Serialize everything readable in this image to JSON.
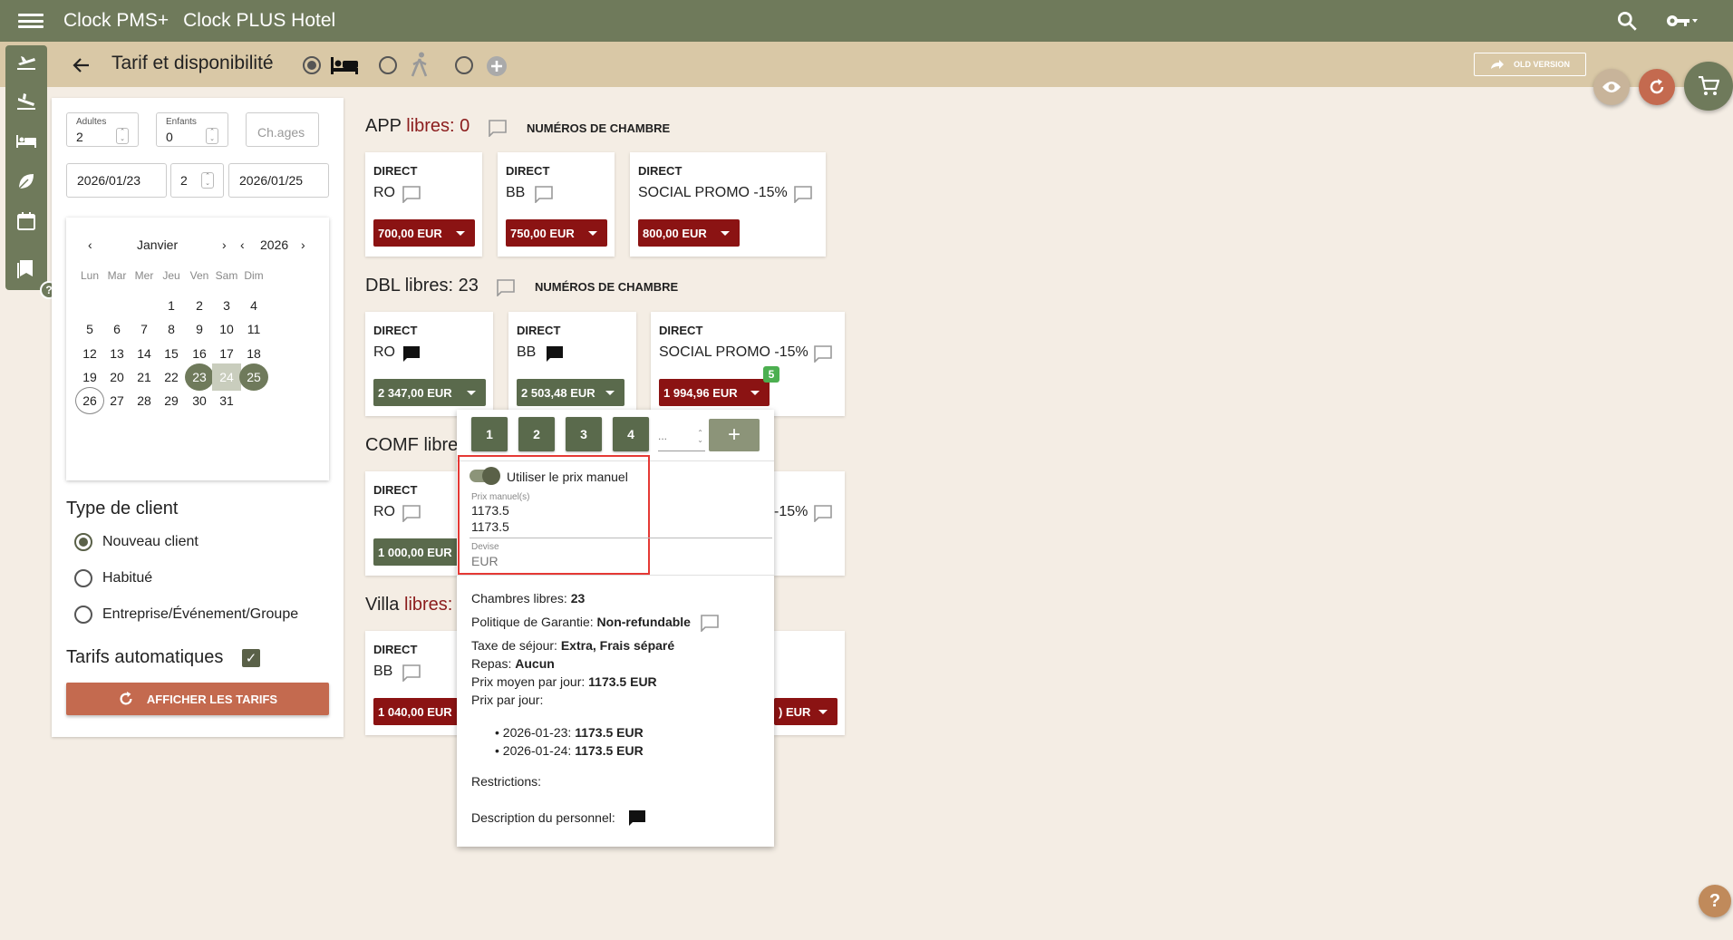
{
  "app": {
    "title": "Clock PMS+",
    "hotel": "Clock PLUS Hotel"
  },
  "subbar": {
    "title": "Tarif et disponibilité",
    "old_version": "OLD VERSION"
  },
  "search": {
    "adults_label": "Adultes",
    "adults": "2",
    "children_label": "Enfants",
    "children": "0",
    "ages_placeholder": "Ch.ages",
    "date_from": "2026/01/23",
    "nights": "2",
    "date_to": "2026/01/25"
  },
  "calendar": {
    "month": "Janvier",
    "year": "2026",
    "weekdays": [
      "Lun",
      "Mar",
      "Mer",
      "Jeu",
      "Ven",
      "Sam",
      "Dim"
    ],
    "days": [
      "1",
      "2",
      "3",
      "4",
      "5",
      "6",
      "7",
      "8",
      "9",
      "10",
      "11",
      "12",
      "13",
      "14",
      "15",
      "16",
      "17",
      "18",
      "19",
      "20",
      "21",
      "22",
      "23",
      "24",
      "25",
      "26",
      "27",
      "28",
      "29",
      "30",
      "31"
    ],
    "range_start": "23",
    "range_mid": "24",
    "range_end": "25",
    "today": "26"
  },
  "client_type": {
    "title": "Type de client",
    "options": [
      "Nouveau client",
      "Habitué",
      "Entreprise/Événement/Groupe"
    ],
    "selected": "Nouveau client"
  },
  "auto_rates": {
    "label": "Tarifs automatiques",
    "checked": true
  },
  "show_rates_button": "AFFICHER LES TARIFS",
  "rooms": [
    {
      "name": "APP",
      "libres_label": "libres: 0",
      "room_numbers": "NUMÉROS DE CHAMBRE",
      "rates": [
        {
          "channel": "DIRECT",
          "name": "RO",
          "price": "700,00 EUR"
        },
        {
          "channel": "DIRECT",
          "name": "BB",
          "price": "750,00 EUR"
        },
        {
          "channel": "DIRECT",
          "name": "SOCIAL PROMO -15%",
          "price": "800,00 EUR"
        }
      ]
    },
    {
      "name": "DBL",
      "libres_label": "libres: 23",
      "room_numbers": "NUMÉROS DE CHAMBRE",
      "rates": [
        {
          "channel": "DIRECT",
          "name": "RO",
          "price": "2 347,00 EUR"
        },
        {
          "channel": "DIRECT",
          "name": "BB",
          "price": "2 503,48 EUR"
        },
        {
          "channel": "DIRECT",
          "name": "SOCIAL PROMO -15%",
          "price": "1 994,96 EUR",
          "badge": "5"
        }
      ]
    },
    {
      "name": "COMF",
      "libres_label": "libre",
      "rates": [
        {
          "channel": "DIRECT",
          "name": "RO",
          "price": "1 000,00 EUR"
        },
        {
          "name_fragment": "-15%"
        }
      ]
    },
    {
      "name": "Villa",
      "libres_label": "libres:",
      "rates": [
        {
          "channel": "DIRECT",
          "name": "BB",
          "price": "1 040,00 EUR"
        },
        {
          "price_fragment": ") EUR"
        }
      ]
    }
  ],
  "popover": {
    "numbers": [
      "1",
      "2",
      "3",
      "4"
    ],
    "dots": "...",
    "manual_toggle_label": "Utiliser le prix manuel",
    "manual_prices_label": "Prix manuel(s)",
    "manual_price_1": "1173.5",
    "manual_price_2": "1173.5",
    "currency_label": "Devise",
    "currency": "EUR",
    "free_rooms_label": "Chambres libres:",
    "free_rooms": "23",
    "guarantee_label": "Politique de Garantie:",
    "guarantee": "Non-refundable",
    "tax_label": "Taxe de séjour:",
    "tax": "Extra, Frais séparé",
    "meals_label": "Repas:",
    "meals": "Aucun",
    "avg_label": "Prix moyen par jour:",
    "avg": "1173.5 EUR",
    "per_day_label": "Prix par jour:",
    "day1_date": "2026-01-23:",
    "day1_price": "1173.5 EUR",
    "day2_date": "2026-01-24:",
    "day2_price": "1173.5 EUR",
    "restrictions_label": "Restrictions:",
    "staff_desc_label": "Description du personnel:"
  },
  "colors": {
    "primary": "#6f7a5b",
    "accent_red": "#8b1313",
    "subbar": "#d9c8a6",
    "button": "#c46a4f",
    "highlight": "#e53935"
  }
}
